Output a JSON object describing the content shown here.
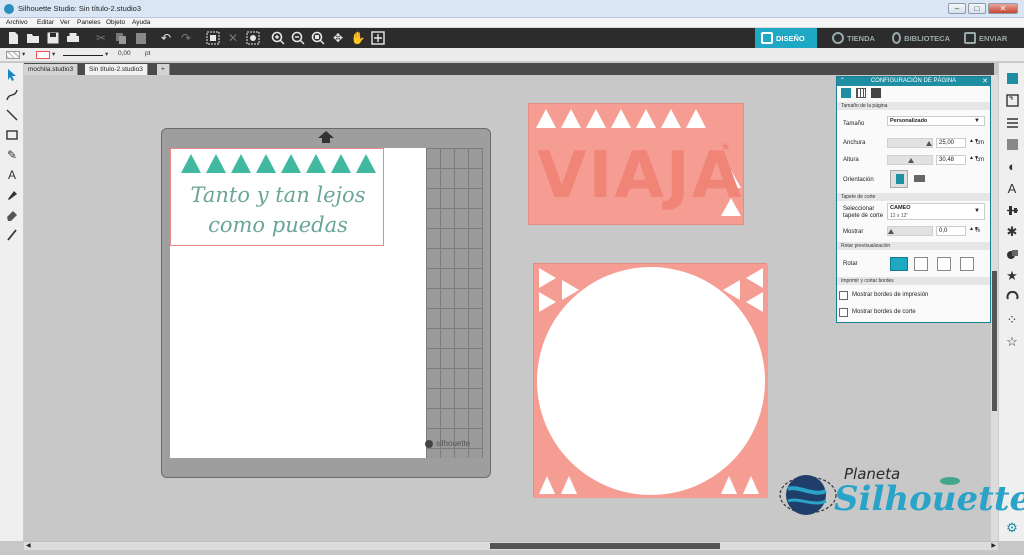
{
  "window": {
    "title": "Silhouette Studio: Sin título-2.studio3",
    "minimize": "–",
    "maximize": "□",
    "close": "✕"
  },
  "menu": [
    "Archivo",
    "Editar",
    "Ver",
    "Paneles",
    "Objeto",
    "Ayuda"
  ],
  "nav_tabs": {
    "design": "DISEÑO",
    "store": "TIENDA",
    "library": "BIBLIOTECA",
    "send": "ENVIAR"
  },
  "line_options": {
    "line_width_value": "0,00",
    "unit": "pt"
  },
  "doc_tabs": [
    "mochila.studio3",
    "Sin título-2.studio3",
    "+"
  ],
  "mat": {
    "brand": "silhouette"
  },
  "artwork": {
    "phrase_line1": "Tanto y tan lejos",
    "phrase_line2": "como puedas",
    "viaja_word": "VIAJA",
    "star": "*"
  },
  "panel": {
    "title": "CONFIGURACIÓN DE PÁGINA",
    "section_page_size": "Tamaño de la página",
    "size_label": "Tamaño",
    "size_value": "Personalizado",
    "width_label": "Anchura",
    "width_value": "25,00",
    "height_label": "Altura",
    "height_value": "30,48",
    "unit_cm": "cm",
    "orientation_label": "Orientación",
    "section_mat": "Tapete de corte",
    "select_mat_label_1": "Seleccionar",
    "select_mat_label_2": "tapete de corte",
    "mat_value": "CAMEO",
    "mat_sub": "12 x 12\"",
    "show_label": "Mostrar",
    "show_value": "0,0",
    "unit_percent": "%",
    "section_rotate": "Rotar previsualización",
    "rotate_label": "Rotar",
    "section_print_cut": "Imprimir y cortar bordes",
    "print_borders": "Mostrar bordes de impresión",
    "cut_borders": "Mostrar bordes de corte"
  },
  "watermark": {
    "top_word": "Planeta",
    "main_word": "Silhouette"
  },
  "colors": {
    "teal_accent": "#1ea8c3",
    "coral": "#f59d93",
    "mint": "#41b9a0",
    "toolbar_dark": "#2c2c2c"
  }
}
